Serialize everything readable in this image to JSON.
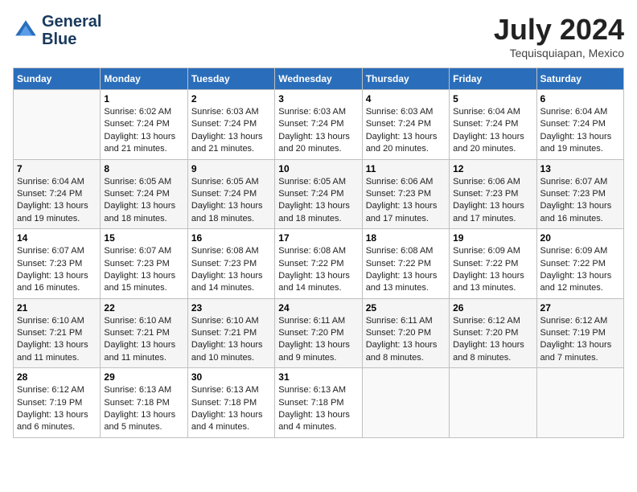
{
  "header": {
    "logo_line1": "General",
    "logo_line2": "Blue",
    "month": "July 2024",
    "location": "Tequisquiapan, Mexico"
  },
  "weekdays": [
    "Sunday",
    "Monday",
    "Tuesday",
    "Wednesday",
    "Thursday",
    "Friday",
    "Saturday"
  ],
  "weeks": [
    [
      {
        "day": "",
        "sunrise": "",
        "sunset": "",
        "daylight": ""
      },
      {
        "day": "1",
        "sunrise": "Sunrise: 6:02 AM",
        "sunset": "Sunset: 7:24 PM",
        "daylight": "Daylight: 13 hours and 21 minutes."
      },
      {
        "day": "2",
        "sunrise": "Sunrise: 6:03 AM",
        "sunset": "Sunset: 7:24 PM",
        "daylight": "Daylight: 13 hours and 21 minutes."
      },
      {
        "day": "3",
        "sunrise": "Sunrise: 6:03 AM",
        "sunset": "Sunset: 7:24 PM",
        "daylight": "Daylight: 13 hours and 20 minutes."
      },
      {
        "day": "4",
        "sunrise": "Sunrise: 6:03 AM",
        "sunset": "Sunset: 7:24 PM",
        "daylight": "Daylight: 13 hours and 20 minutes."
      },
      {
        "day": "5",
        "sunrise": "Sunrise: 6:04 AM",
        "sunset": "Sunset: 7:24 PM",
        "daylight": "Daylight: 13 hours and 20 minutes."
      },
      {
        "day": "6",
        "sunrise": "Sunrise: 6:04 AM",
        "sunset": "Sunset: 7:24 PM",
        "daylight": "Daylight: 13 hours and 19 minutes."
      }
    ],
    [
      {
        "day": "7",
        "sunrise": "Sunrise: 6:04 AM",
        "sunset": "Sunset: 7:24 PM",
        "daylight": "Daylight: 13 hours and 19 minutes."
      },
      {
        "day": "8",
        "sunrise": "Sunrise: 6:05 AM",
        "sunset": "Sunset: 7:24 PM",
        "daylight": "Daylight: 13 hours and 18 minutes."
      },
      {
        "day": "9",
        "sunrise": "Sunrise: 6:05 AM",
        "sunset": "Sunset: 7:24 PM",
        "daylight": "Daylight: 13 hours and 18 minutes."
      },
      {
        "day": "10",
        "sunrise": "Sunrise: 6:05 AM",
        "sunset": "Sunset: 7:24 PM",
        "daylight": "Daylight: 13 hours and 18 minutes."
      },
      {
        "day": "11",
        "sunrise": "Sunrise: 6:06 AM",
        "sunset": "Sunset: 7:23 PM",
        "daylight": "Daylight: 13 hours and 17 minutes."
      },
      {
        "day": "12",
        "sunrise": "Sunrise: 6:06 AM",
        "sunset": "Sunset: 7:23 PM",
        "daylight": "Daylight: 13 hours and 17 minutes."
      },
      {
        "day": "13",
        "sunrise": "Sunrise: 6:07 AM",
        "sunset": "Sunset: 7:23 PM",
        "daylight": "Daylight: 13 hours and 16 minutes."
      }
    ],
    [
      {
        "day": "14",
        "sunrise": "Sunrise: 6:07 AM",
        "sunset": "Sunset: 7:23 PM",
        "daylight": "Daylight: 13 hours and 16 minutes."
      },
      {
        "day": "15",
        "sunrise": "Sunrise: 6:07 AM",
        "sunset": "Sunset: 7:23 PM",
        "daylight": "Daylight: 13 hours and 15 minutes."
      },
      {
        "day": "16",
        "sunrise": "Sunrise: 6:08 AM",
        "sunset": "Sunset: 7:23 PM",
        "daylight": "Daylight: 13 hours and 14 minutes."
      },
      {
        "day": "17",
        "sunrise": "Sunrise: 6:08 AM",
        "sunset": "Sunset: 7:22 PM",
        "daylight": "Daylight: 13 hours and 14 minutes."
      },
      {
        "day": "18",
        "sunrise": "Sunrise: 6:08 AM",
        "sunset": "Sunset: 7:22 PM",
        "daylight": "Daylight: 13 hours and 13 minutes."
      },
      {
        "day": "19",
        "sunrise": "Sunrise: 6:09 AM",
        "sunset": "Sunset: 7:22 PM",
        "daylight": "Daylight: 13 hours and 13 minutes."
      },
      {
        "day": "20",
        "sunrise": "Sunrise: 6:09 AM",
        "sunset": "Sunset: 7:22 PM",
        "daylight": "Daylight: 13 hours and 12 minutes."
      }
    ],
    [
      {
        "day": "21",
        "sunrise": "Sunrise: 6:10 AM",
        "sunset": "Sunset: 7:21 PM",
        "daylight": "Daylight: 13 hours and 11 minutes."
      },
      {
        "day": "22",
        "sunrise": "Sunrise: 6:10 AM",
        "sunset": "Sunset: 7:21 PM",
        "daylight": "Daylight: 13 hours and 11 minutes."
      },
      {
        "day": "23",
        "sunrise": "Sunrise: 6:10 AM",
        "sunset": "Sunset: 7:21 PM",
        "daylight": "Daylight: 13 hours and 10 minutes."
      },
      {
        "day": "24",
        "sunrise": "Sunrise: 6:11 AM",
        "sunset": "Sunset: 7:20 PM",
        "daylight": "Daylight: 13 hours and 9 minutes."
      },
      {
        "day": "25",
        "sunrise": "Sunrise: 6:11 AM",
        "sunset": "Sunset: 7:20 PM",
        "daylight": "Daylight: 13 hours and 8 minutes."
      },
      {
        "day": "26",
        "sunrise": "Sunrise: 6:12 AM",
        "sunset": "Sunset: 7:20 PM",
        "daylight": "Daylight: 13 hours and 8 minutes."
      },
      {
        "day": "27",
        "sunrise": "Sunrise: 6:12 AM",
        "sunset": "Sunset: 7:19 PM",
        "daylight": "Daylight: 13 hours and 7 minutes."
      }
    ],
    [
      {
        "day": "28",
        "sunrise": "Sunrise: 6:12 AM",
        "sunset": "Sunset: 7:19 PM",
        "daylight": "Daylight: 13 hours and 6 minutes."
      },
      {
        "day": "29",
        "sunrise": "Sunrise: 6:13 AM",
        "sunset": "Sunset: 7:18 PM",
        "daylight": "Daylight: 13 hours and 5 minutes."
      },
      {
        "day": "30",
        "sunrise": "Sunrise: 6:13 AM",
        "sunset": "Sunset: 7:18 PM",
        "daylight": "Daylight: 13 hours and 4 minutes."
      },
      {
        "day": "31",
        "sunrise": "Sunrise: 6:13 AM",
        "sunset": "Sunset: 7:18 PM",
        "daylight": "Daylight: 13 hours and 4 minutes."
      },
      {
        "day": "",
        "sunrise": "",
        "sunset": "",
        "daylight": ""
      },
      {
        "day": "",
        "sunrise": "",
        "sunset": "",
        "daylight": ""
      },
      {
        "day": "",
        "sunrise": "",
        "sunset": "",
        "daylight": ""
      }
    ]
  ]
}
